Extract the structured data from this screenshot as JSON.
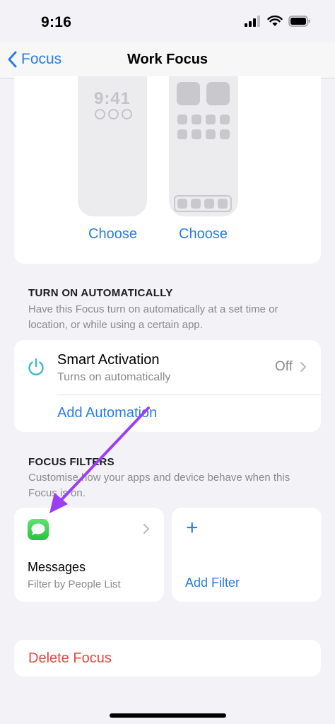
{
  "status_bar": {
    "time": "9:16"
  },
  "nav": {
    "back_label": "Focus",
    "title": "Work Focus"
  },
  "customize": {
    "lock_preview_time": "9:41",
    "choose_lock_label": "Choose",
    "choose_home_label": "Choose"
  },
  "automatic": {
    "header": "TURN ON AUTOMATICALLY",
    "description": "Have this Focus turn on automatically at a set time or location, or while using a certain app.",
    "smart_activation": {
      "title": "Smart Activation",
      "subtitle": "Turns on automatically",
      "value": "Off",
      "icon": "power-icon"
    },
    "add_automation_label": "Add Automation"
  },
  "filters": {
    "header": "FOCUS FILTERS",
    "description": "Customise how your apps and device behave when this Focus is on.",
    "items": [
      {
        "title": "Messages",
        "subtitle": "Filter by People List",
        "icon": "messages-icon"
      }
    ],
    "add_filter_label": "Add Filter"
  },
  "delete_label": "Delete Focus",
  "colors": {
    "accent": "#2a7de1",
    "destructive": "#e5483d",
    "annotation_arrow": "#9b3ff5",
    "background": "#f2f2f7"
  }
}
